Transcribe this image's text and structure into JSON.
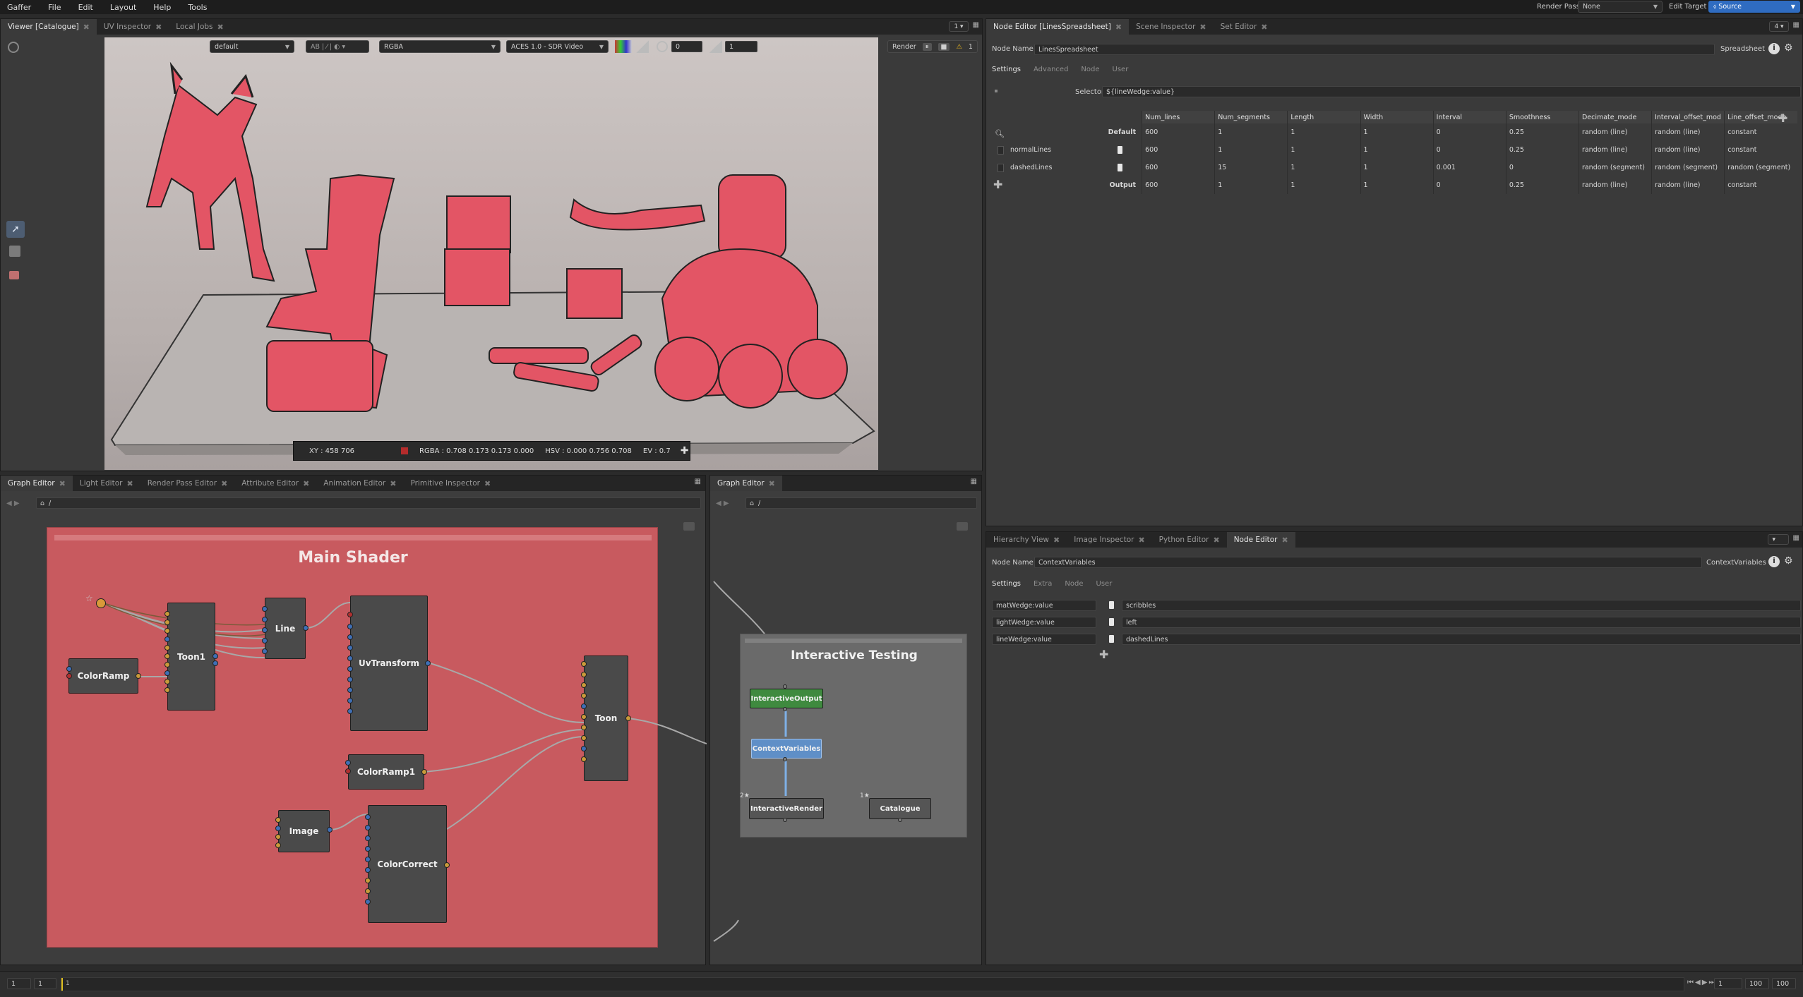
{
  "app": {
    "menu": [
      "Gaffer",
      "File",
      "Edit",
      "Layout",
      "Help",
      "Tools"
    ],
    "render_pass_label": "Render Pass",
    "render_pass_value": "None",
    "edit_target_label": "Edit Target",
    "edit_target_value": "Source"
  },
  "viewer": {
    "tabs": [
      {
        "label": "Viewer [Catalogue]",
        "active": true
      },
      {
        "label": "UV Inspector"
      },
      {
        "label": "Local Jobs"
      }
    ],
    "tab_right": "1 ▾",
    "toolbar": {
      "camera": "default",
      "display": "RGBA",
      "colorspace": "ACES 1.0 - SDR Video",
      "exposure": "0",
      "gamma": "1",
      "render_label": "Render",
      "warning_count": "1"
    },
    "pixel_info": {
      "xy": "XY : 458 706",
      "rgba": "RGBA : 0.708 0.173 0.173 0.000",
      "hsv": "HSV : 0.000 0.756 0.708",
      "ev": "EV : 0.7"
    }
  },
  "spreadsheet_editor": {
    "tabs": [
      {
        "label": "Node Editor [LinesSpreadsheet]",
        "active": true
      },
      {
        "label": "Scene Inspector"
      },
      {
        "label": "Set Editor"
      }
    ],
    "tab_right": "4 ▾",
    "node_name_label": "Node Name",
    "node_name": "LinesSpreadsheet",
    "node_type": "Spreadsheet",
    "subtabs": [
      "Settings",
      "Advanced",
      "Node",
      "User"
    ],
    "selector_label": "Selector",
    "selector_value": "${lineWedge:value}",
    "columns": [
      "Num_lines",
      "Num_segments",
      "Length",
      "Width",
      "Interval",
      "Smoothness",
      "Decimate_mode",
      "Interval_offset_mod",
      "Line_offset_mode"
    ],
    "rows": [
      {
        "name": "Default",
        "values": [
          "600",
          "1",
          "1",
          "1",
          "0",
          "0.25",
          "random (line)",
          "random (line)",
          "constant"
        ]
      },
      {
        "name": "normalLines",
        "values": [
          "600",
          "1",
          "1",
          "1",
          "0",
          "0.25",
          "random (line)",
          "random (line)",
          "constant"
        ]
      },
      {
        "name": "dashedLines",
        "values": [
          "600",
          "15",
          "1",
          "1",
          "0.001",
          "0",
          "random (segment)",
          "random (segment)",
          "random (segment)"
        ]
      },
      {
        "name": "Output",
        "values": [
          "600",
          "1",
          "1",
          "1",
          "0",
          "0.25",
          "random (line)",
          "random (line)",
          "constant"
        ]
      }
    ]
  },
  "context_editor": {
    "tabs": [
      {
        "label": "Hierarchy View"
      },
      {
        "label": "Image Inspector"
      },
      {
        "label": "Python Editor"
      },
      {
        "label": "Node Editor",
        "active": true
      }
    ],
    "node_name_label": "Node Name",
    "node_name": "ContextVariables",
    "node_type": "ContextVariables",
    "subtabs": [
      "Settings",
      "Extra",
      "Node",
      "User"
    ],
    "variables": [
      {
        "name": "matWedge:value",
        "value": "scribbles"
      },
      {
        "name": "lightWedge:value",
        "value": "left"
      },
      {
        "name": "lineWedge:value",
        "value": "dashedLines"
      }
    ]
  },
  "graph_left": {
    "tabs": [
      {
        "label": "Graph Editor",
        "active": true
      },
      {
        "label": "Light Editor"
      },
      {
        "label": "Render Pass Editor"
      },
      {
        "label": "Attribute Editor"
      },
      {
        "label": "Animation Editor"
      },
      {
        "label": "Primitive Inspector"
      }
    ],
    "path": "/",
    "backdrop_title": "Main Shader",
    "nodes": [
      "Toon1",
      "Line",
      "UvTransform",
      "ColorRamp",
      "Toon",
      "ColorRamp1",
      "Image",
      "ColorCorrect"
    ]
  },
  "graph_right": {
    "tabs": [
      {
        "label": "Graph Editor",
        "active": true
      }
    ],
    "path": "/",
    "backdrop_title": "Interactive Testing",
    "nodes": [
      "InteractiveOutput",
      "ContextVariables",
      "InteractiveRender",
      "Catalogue"
    ],
    "bookmarks": [
      "2",
      "1"
    ]
  },
  "timeline": {
    "start": "1",
    "current": "1",
    "marker": "1",
    "frame": "1",
    "end_range": "100",
    "end": "100"
  },
  "colors": {
    "backdrop_shader": "#c85a5f",
    "selected_node": "#5f8fc7",
    "output_node": "#3f8a3f",
    "accent": "#2f6cc1"
  }
}
